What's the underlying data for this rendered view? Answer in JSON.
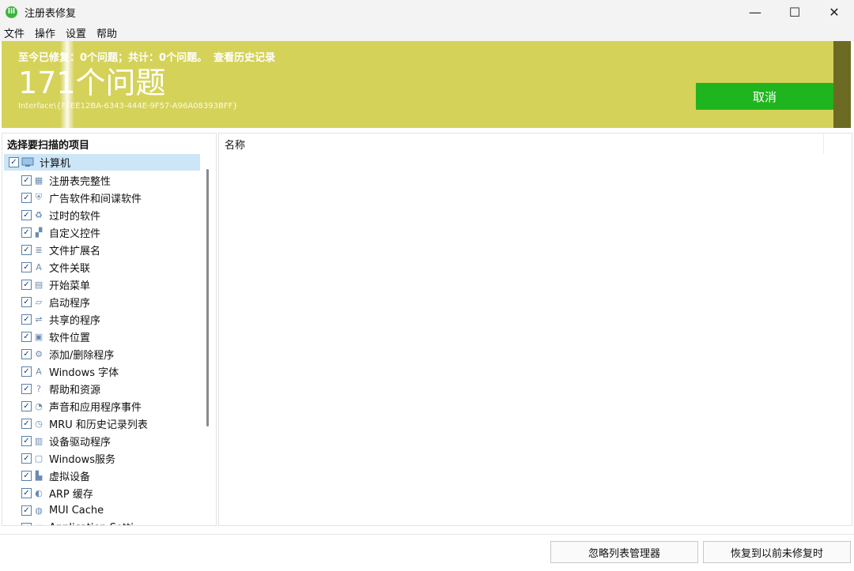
{
  "window": {
    "title": "注册表修复",
    "app_icon_glyph": "lil",
    "controls": {
      "minimize": "—",
      "maximize": "☐",
      "close": "✕"
    }
  },
  "menu": [
    "文件",
    "操作",
    "设置",
    "帮助"
  ],
  "banner": {
    "summary": "至今已修复：0个问题；共计：0个问题。",
    "history_link": "查看历史记录",
    "count": "171个问题",
    "path": "Interface\\{FFEE12BA-6343-444E-9F57-A96A08393BFF}",
    "cancel_label": "取消",
    "colors": {
      "background": "#d5d25a",
      "cancel": "#1fb51f"
    }
  },
  "left_panel": {
    "heading": "选择要扫描的项目",
    "root": {
      "label": "计算机",
      "checked": true,
      "icon": "computer-icon"
    },
    "items": [
      {
        "label": "注册表完整性",
        "icon": "registry-icon",
        "glyph": "▦"
      },
      {
        "label": "广告软件和间谍软件",
        "icon": "shield-icon",
        "glyph": "⛨"
      },
      {
        "label": "过时的软件",
        "icon": "trash-icon",
        "glyph": "♻"
      },
      {
        "label": "自定义控件",
        "icon": "controls-icon",
        "glyph": "▞"
      },
      {
        "label": "文件扩展名",
        "icon": "document-icon",
        "glyph": "≣"
      },
      {
        "label": "文件关联",
        "icon": "font-a-icon",
        "glyph": "A"
      },
      {
        "label": "开始菜单",
        "icon": "start-menu-icon",
        "glyph": "▤"
      },
      {
        "label": "启动程序",
        "icon": "startup-icon",
        "glyph": "▱"
      },
      {
        "label": "共享的程序",
        "icon": "share-icon",
        "glyph": "⇌"
      },
      {
        "label": "软件位置",
        "icon": "folder-icon",
        "glyph": "▣"
      },
      {
        "label": "添加/删除程序",
        "icon": "install-icon",
        "glyph": "⚙"
      },
      {
        "label": "Windows 字体",
        "icon": "font-icon",
        "glyph": "A"
      },
      {
        "label": "帮助和资源",
        "icon": "help-icon",
        "glyph": "?"
      },
      {
        "label": "声音和应用程序事件",
        "icon": "sound-icon",
        "glyph": "◔"
      },
      {
        "label": "MRU 和历史记录列表",
        "icon": "history-icon",
        "glyph": "◷"
      },
      {
        "label": "设备驱动程序",
        "icon": "driver-icon",
        "glyph": "▥"
      },
      {
        "label": "Windows服务",
        "icon": "service-icon",
        "glyph": "▢"
      },
      {
        "label": "虚拟设备",
        "icon": "virtual-device-icon",
        "glyph": "▙"
      },
      {
        "label": "ARP 缓存",
        "icon": "arp-icon",
        "glyph": "◐"
      },
      {
        "label": "MUI Cache",
        "icon": "cache-icon",
        "glyph": "◍"
      },
      {
        "label": "Application Setti",
        "icon": "settings-icon",
        "glyph": "▧"
      }
    ]
  },
  "right_panel": {
    "column_header": "名称"
  },
  "bottom": {
    "ignore_label": "忽略列表管理器",
    "restore_label": "恢复到以前未修复时"
  }
}
